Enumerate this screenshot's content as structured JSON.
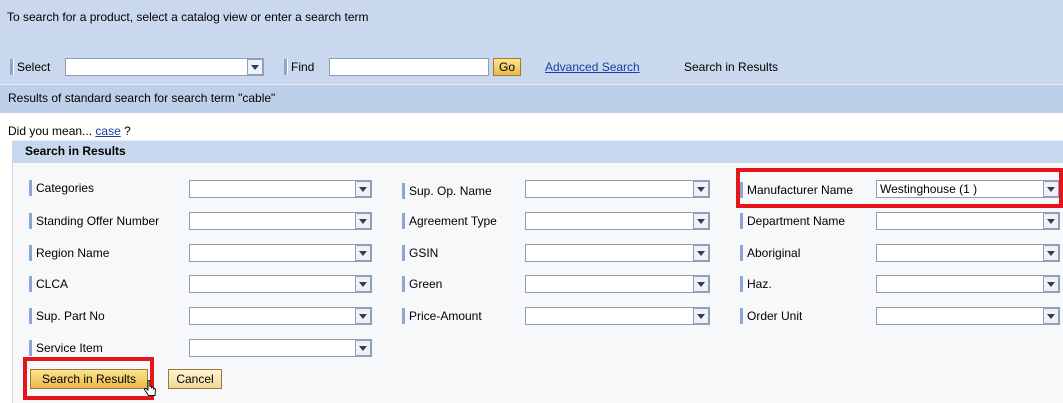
{
  "header": {
    "intro": "To search for a product, select a catalog view or enter a search term"
  },
  "toolbar": {
    "select_label": "Select",
    "select_value": "",
    "find_label": "Find",
    "find_value": "",
    "go_label": "Go",
    "advanced_search": "Advanced Search",
    "search_in_results": "Search in Results"
  },
  "results": {
    "text": "Results of standard search for search term \"cable\""
  },
  "did_you_mean": {
    "prefix": "Did you mean...",
    "suggestion": "case",
    "suffix": "?"
  },
  "panel": {
    "title": "Search in Results",
    "filters": [
      {
        "label": "Categories",
        "value": ""
      },
      {
        "label": "Sup. Op. Name",
        "value": ""
      },
      {
        "label": "Manufacturer Name",
        "value": "Westinghouse (1 )"
      },
      {
        "label": "Standing Offer Number",
        "value": ""
      },
      {
        "label": "Agreement Type",
        "value": ""
      },
      {
        "label": "Department Name",
        "value": ""
      },
      {
        "label": "Region Name",
        "value": ""
      },
      {
        "label": "GSIN",
        "value": ""
      },
      {
        "label": "Aboriginal",
        "value": ""
      },
      {
        "label": "CLCA",
        "value": ""
      },
      {
        "label": "Green",
        "value": ""
      },
      {
        "label": "Haz.",
        "value": ""
      },
      {
        "label": "Sup. Part No",
        "value": ""
      },
      {
        "label": "Price-Amount",
        "value": ""
      },
      {
        "label": "Order Unit",
        "value": ""
      },
      {
        "label": "Service Item",
        "value": ""
      }
    ],
    "search_button": "Search in Results",
    "cancel_button": "Cancel"
  },
  "colors": {
    "highlight": "#e8141b",
    "header_band": "#c9d8ec",
    "link": "#1b3fa0"
  }
}
